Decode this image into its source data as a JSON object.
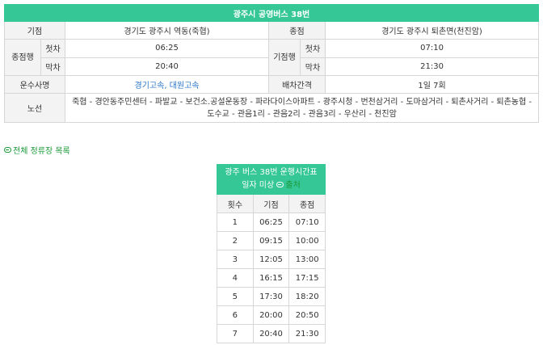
{
  "title": "광주시 공영버스 38번",
  "info": {
    "start_label": "기점",
    "start_value": "경기도 광주시 역동(죽협)",
    "end_label": "종점",
    "end_value": "경기도 광주시 퇴촌면(천진암)",
    "terminal_label_1": "종점행",
    "first_label": "첫차",
    "last_label": "막차",
    "first_left": "06:25",
    "last_left": "20:40",
    "terminal_label_2": "기점행",
    "first_right": "07:10",
    "last_right": "21:30",
    "operator_label": "운수사명",
    "operator_value": "경기고속, 대원고속",
    "interval_label": "배차간격",
    "interval_value": "1일 7회",
    "route_label": "노선",
    "route_value": "죽협 - 경안동주민센터 - 파발교 - 보건소.공설운동장 - 파라다이스아파트 - 광주시청 - 번천삼거리 - 도마삼거리 - 퇴촌사거리 - 퇴촌농협 - 도수교 - 관음1리 - 관음2리 - 관음3리 - 우산리 - 천진암"
  },
  "stop_list_link": "전체 정류장 목록",
  "schedule": {
    "title": "광주 버스 38번 운행시간표",
    "subtitle": "일자 미상",
    "source_label": "출처",
    "col_no": "횟수",
    "col_start": "기점",
    "col_end": "종점",
    "rows": [
      {
        "no": "1",
        "start": "06:25",
        "end": "07:10"
      },
      {
        "no": "2",
        "start": "09:15",
        "end": "10:00"
      },
      {
        "no": "3",
        "start": "12:05",
        "end": "13:00"
      },
      {
        "no": "4",
        "start": "16:15",
        "end": "17:15"
      },
      {
        "no": "5",
        "start": "17:30",
        "end": "18:20"
      },
      {
        "no": "6",
        "start": "20:00",
        "end": "20:50"
      },
      {
        "no": "7",
        "start": "20:40",
        "end": "21:30"
      }
    ]
  },
  "colors": {
    "header": "#35c795",
    "link": "#2a76c6",
    "green_link": "#1b9a3a"
  }
}
